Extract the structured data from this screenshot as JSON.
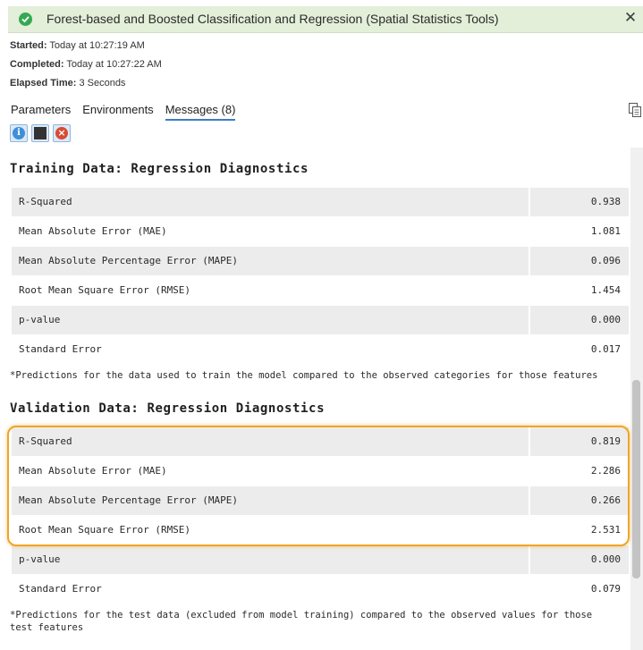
{
  "header": {
    "title": "Forest-based and Boosted Classification and Regression (Spatial Statistics Tools)",
    "status_icon": "success-check-icon",
    "close_icon": "close-icon"
  },
  "meta": {
    "started_label": "Started:",
    "started_value": "Today at 10:27:19 AM",
    "completed_label": "Completed:",
    "completed_value": "Today at 10:27:22 AM",
    "elapsed_label": "Elapsed Time:",
    "elapsed_value": "3 Seconds"
  },
  "tabs": [
    {
      "label": "Parameters",
      "active": false
    },
    {
      "label": "Environments",
      "active": false
    },
    {
      "label": "Messages (8)",
      "active": true
    }
  ],
  "filters": [
    "info-icon",
    "warning-icon",
    "error-icon"
  ],
  "training": {
    "title": "Training Data: Regression Diagnostics",
    "rows": [
      {
        "label": "R-Squared",
        "value": "0.938"
      },
      {
        "label": "Mean Absolute Error (MAE)",
        "value": "1.081"
      },
      {
        "label": "Mean Absolute Percentage Error (MAPE)",
        "value": "0.096"
      },
      {
        "label": "Root Mean Square Error (RMSE)",
        "value": "1.454"
      },
      {
        "label": "p-value",
        "value": "0.000"
      },
      {
        "label": "Standard Error",
        "value": "0.017"
      }
    ],
    "note": "*Predictions for the data used to train the model compared to the observed categories for those features"
  },
  "validation": {
    "title": "Validation Data: Regression Diagnostics",
    "rows": [
      {
        "label": "R-Squared",
        "value": "0.819"
      },
      {
        "label": "Mean Absolute Error (MAE)",
        "value": "2.286"
      },
      {
        "label": "Mean Absolute Percentage Error (MAPE)",
        "value": "0.266"
      },
      {
        "label": "Root Mean Square Error (RMSE)",
        "value": "2.531"
      },
      {
        "label": "p-value",
        "value": "0.000"
      },
      {
        "label": "Standard Error",
        "value": "0.079"
      }
    ],
    "note": "*Predictions for the test data (excluded from model training) compared to the observed values for those test features"
  },
  "colors": {
    "header_bg": "#e3efd9",
    "success": "#35a853",
    "highlight": "#f0a524",
    "tab_underline": "#3b7dc3"
  }
}
